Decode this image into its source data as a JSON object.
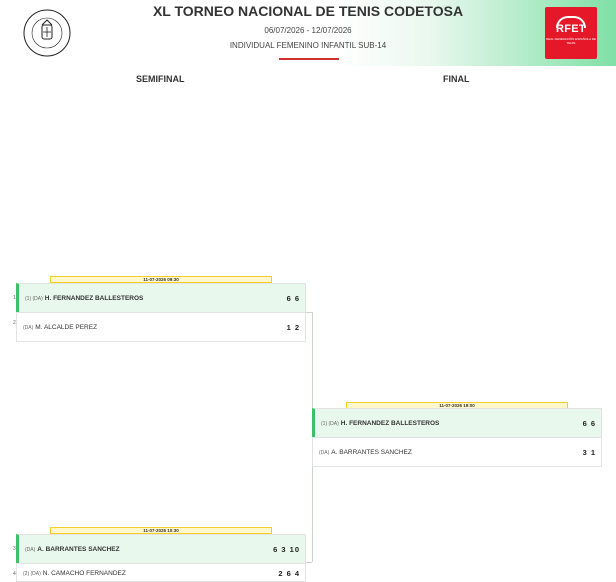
{
  "header": {
    "title": "XL TORNEO NACIONAL DE TENIS CODETOSA",
    "dates": "06/07/2026 - 12/07/2026",
    "category": "INDIVIDUAL FEMENINO INFANTIL SUB-14",
    "left_logo": "FEDERACIÓN DE TENIS CASTILLA LA MANCHA",
    "right_logo": "RFET",
    "right_logo_sub": "REAL FEDERACIÓN ESPAÑOLA DE TENIS"
  },
  "rounds": {
    "semifinal": "SEMIFINAL",
    "final": "FINAL"
  },
  "matches": {
    "sf1": {
      "time": "11-07-2026 09:30",
      "p1": {
        "num": "1",
        "seed": "(1) (DA)",
        "name": "H. FERNANDEZ BALLESTEROS",
        "score": "6 6"
      },
      "p2": {
        "num": "2",
        "seed": "(DA)",
        "name": "M. ALCALDE PEREZ",
        "score": "1 2"
      }
    },
    "sf2": {
      "time": "11-07-2026 10:30",
      "p1": {
        "num": "3",
        "seed": "(DA)",
        "name": "A. BARRANTES SANCHEZ",
        "score": "6 3 10"
      },
      "p2": {
        "num": "4",
        "seed": "(2) (DA)",
        "name": "N. CAMACHO FERNANDEZ",
        "score": "2 6 4"
      }
    },
    "final": {
      "time": "11-07-2026 19:00",
      "p1": {
        "seed": "(1) (DA)",
        "name": "H. FERNANDEZ BALLESTEROS",
        "score": "6 6"
      },
      "p2": {
        "seed": "(DA)",
        "name": "A. BARRANTES SANCHEZ",
        "score": "3 1"
      }
    }
  },
  "colors": {
    "accent_green": "#3ec066",
    "brand_red": "#e5182a",
    "time_tag_border": "#f2cf2e"
  }
}
